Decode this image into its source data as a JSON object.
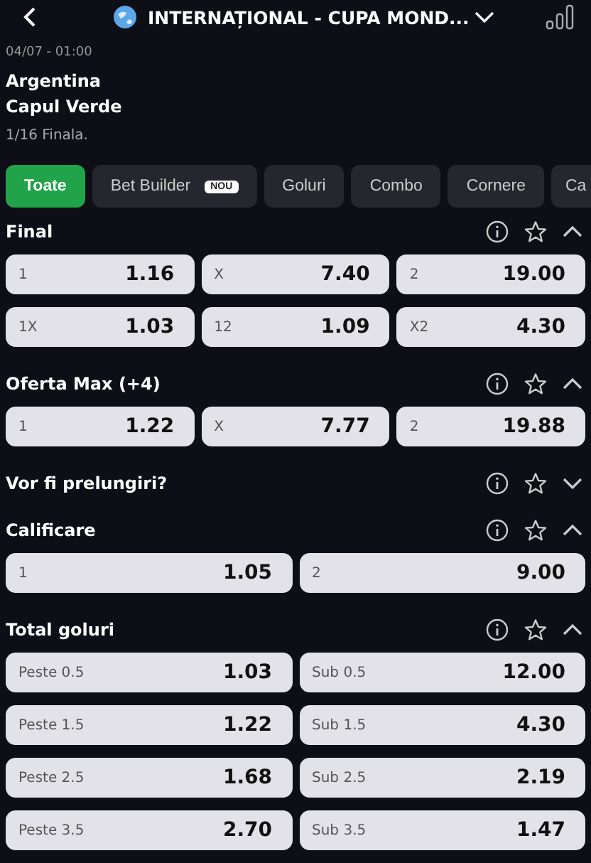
{
  "header": {
    "title": "INTERNAȚIONAL - CUPA MOND..."
  },
  "match": {
    "datetime": "04/07 - 01:00",
    "home": "Argentina",
    "away": "Capul Verde",
    "round": "1/16 Finala."
  },
  "tabs": [
    {
      "label": "Toate",
      "selected": true
    },
    {
      "label": "Bet Builder",
      "selected": false,
      "badge": "NOU"
    },
    {
      "label": "Goluri",
      "selected": false
    },
    {
      "label": "Combo",
      "selected": false
    },
    {
      "label": "Cornere",
      "selected": false
    },
    {
      "label": "Ca",
      "selected": false
    }
  ],
  "markets": [
    {
      "title": "Final",
      "expanded": true,
      "rows": [
        [
          {
            "label": "1",
            "odds": "1.16"
          },
          {
            "label": "X",
            "odds": "7.40"
          },
          {
            "label": "2",
            "odds": "19.00"
          }
        ],
        [
          {
            "label": "1X",
            "odds": "1.03"
          },
          {
            "label": "12",
            "odds": "1.09"
          },
          {
            "label": "X2",
            "odds": "4.30"
          }
        ]
      ]
    },
    {
      "title": "Oferta Max (+4)",
      "expanded": true,
      "rows": [
        [
          {
            "label": "1",
            "odds": "1.22"
          },
          {
            "label": "X",
            "odds": "7.77"
          },
          {
            "label": "2",
            "odds": "19.88"
          }
        ]
      ]
    },
    {
      "title": "Vor fi prelungiri?",
      "expanded": false
    },
    {
      "title": "Calificare",
      "expanded": true,
      "rows": [
        [
          {
            "label": "1",
            "odds": "1.05"
          },
          {
            "label": "2",
            "odds": "9.00"
          }
        ]
      ]
    },
    {
      "title": "Total goluri",
      "expanded": true,
      "rows": [
        [
          {
            "label": "Peste 0.5",
            "odds": "1.03"
          },
          {
            "label": "Sub 0.5",
            "odds": "12.00"
          }
        ],
        [
          {
            "label": "Peste 1.5",
            "odds": "1.22"
          },
          {
            "label": "Sub 1.5",
            "odds": "4.30"
          }
        ],
        [
          {
            "label": "Peste 2.5",
            "odds": "1.68"
          },
          {
            "label": "Sub 2.5",
            "odds": "2.19"
          }
        ],
        [
          {
            "label": "Peste 3.5",
            "odds": "2.70"
          },
          {
            "label": "Sub 3.5",
            "odds": "1.47"
          }
        ]
      ]
    }
  ]
}
